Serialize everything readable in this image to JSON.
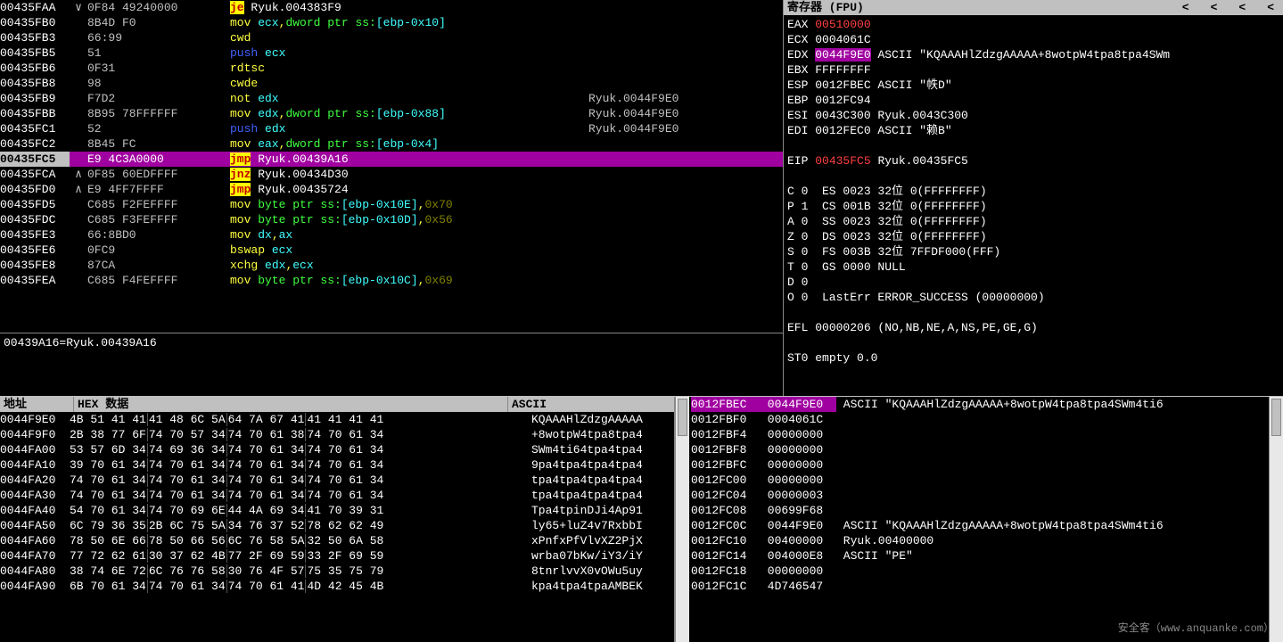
{
  "disasm": {
    "rows": [
      {
        "addr": "00435FAA",
        "arr": "∨",
        "bytes": "0F84 49240000",
        "mnem": "je",
        "mnemCls": "hl-yellow",
        "args": [
          {
            "t": " Ryuk.004383F9",
            "c": "white"
          }
        ]
      },
      {
        "addr": "00435FB0",
        "bytes": "8B4D F0",
        "mnem": "mov",
        "mnemCls": "yellow",
        "args": [
          {
            "t": " ecx",
            "c": "cyan"
          },
          {
            "t": ",",
            "c": "yellow"
          },
          {
            "t": "dword ptr ss:",
            "c": "green"
          },
          {
            "t": "[ebp-0x10]",
            "c": "cyan"
          }
        ]
      },
      {
        "addr": "00435FB3",
        "bytes": "66:99",
        "mnem": "cwd",
        "mnemCls": "yellow"
      },
      {
        "addr": "00435FB5",
        "bytes": "51",
        "mnem": "push",
        "mnemCls": "blue",
        "args": [
          {
            "t": " ecx",
            "c": "cyan"
          }
        ]
      },
      {
        "addr": "00435FB6",
        "bytes": "0F31",
        "mnem": "rdtsc",
        "mnemCls": "yellow"
      },
      {
        "addr": "00435FB8",
        "bytes": "98",
        "mnem": "cwde",
        "mnemCls": "yellow"
      },
      {
        "addr": "00435FB9",
        "bytes": "F7D2",
        "mnem": "not",
        "mnemCls": "yellow",
        "args": [
          {
            "t": " edx",
            "c": "cyan"
          }
        ],
        "cmt": "Ryuk.0044F9E0"
      },
      {
        "addr": "00435FBB",
        "bytes": "8B95 78FFFFFF",
        "mnem": "mov",
        "mnemCls": "yellow",
        "args": [
          {
            "t": " edx",
            "c": "cyan"
          },
          {
            "t": ",",
            "c": "yellow"
          },
          {
            "t": "dword ptr ss:",
            "c": "green"
          },
          {
            "t": "[ebp-0x88]",
            "c": "cyan"
          }
        ],
        "cmt": "Ryuk.0044F9E0"
      },
      {
        "addr": "00435FC1",
        "bytes": "52",
        "mnem": "push",
        "mnemCls": "blue",
        "args": [
          {
            "t": " edx",
            "c": "cyan"
          }
        ],
        "cmt": "Ryuk.0044F9E0"
      },
      {
        "addr": "00435FC2",
        "bytes": "8B45 FC",
        "mnem": "mov",
        "mnemCls": "yellow",
        "args": [
          {
            "t": " eax",
            "c": "cyan"
          },
          {
            "t": ",",
            "c": "yellow"
          },
          {
            "t": "dword ptr ss:",
            "c": "green"
          },
          {
            "t": "[ebp-0x4]",
            "c": "cyan"
          }
        ]
      },
      {
        "addr": "00435FC5",
        "sel": true,
        "bytes": "E9 4C3A0000",
        "mnem": "jmp",
        "mnemCls": "hl-yellow",
        "args": [
          {
            "t": " Ryuk.00439A16",
            "c": "white"
          }
        ],
        "rowCls": "hl-mag"
      },
      {
        "addr": "00435FCA",
        "arr": "∧",
        "bytes": "0F85 60EDFFFF",
        "mnem": "jnz",
        "mnemCls": "hl-yellow",
        "args": [
          {
            "t": " Ryuk.00434D30",
            "c": "white"
          }
        ]
      },
      {
        "addr": "00435FD0",
        "arr": "∧",
        "bytes": "E9 4FF7FFFF",
        "mnem": "jmp",
        "mnemCls": "hl-yellow",
        "args": [
          {
            "t": " Ryuk.00435724",
            "c": "white"
          }
        ]
      },
      {
        "addr": "00435FD5",
        "bytes": "C685 F2FEFFFF ",
        "mnem": "mov",
        "mnemCls": "yellow",
        "args": [
          {
            "t": " byte ptr ss:",
            "c": "green"
          },
          {
            "t": "[ebp-0x10E]",
            "c": "cyan"
          },
          {
            "t": ",",
            "c": "yellow"
          },
          {
            "t": "0x70",
            "c": "olive"
          }
        ]
      },
      {
        "addr": "00435FDC",
        "bytes": "C685 F3FEFFFF ",
        "mnem": "mov",
        "mnemCls": "yellow",
        "args": [
          {
            "t": " byte ptr ss:",
            "c": "green"
          },
          {
            "t": "[ebp-0x10D]",
            "c": "cyan"
          },
          {
            "t": ",",
            "c": "yellow"
          },
          {
            "t": "0x56",
            "c": "olive"
          }
        ]
      },
      {
        "addr": "00435FE3",
        "bytes": "66:8BD0",
        "mnem": "mov",
        "mnemCls": "yellow",
        "args": [
          {
            "t": " dx",
            "c": "cyan"
          },
          {
            "t": ",",
            "c": "yellow"
          },
          {
            "t": "ax",
            "c": "cyan"
          }
        ]
      },
      {
        "addr": "00435FE6",
        "bytes": "0FC9",
        "mnem": "bswap",
        "mnemCls": "yellow",
        "args": [
          {
            "t": " ecx",
            "c": "cyan"
          }
        ]
      },
      {
        "addr": "00435FE8",
        "bytes": "87CA",
        "mnem": "xchg",
        "mnemCls": "yellow",
        "args": [
          {
            "t": " edx",
            "c": "cyan"
          },
          {
            "t": ",",
            "c": "yellow"
          },
          {
            "t": "ecx",
            "c": "cyan"
          }
        ]
      },
      {
        "addr": "00435FEA",
        "bytes": "C685 F4FEFFFF ",
        "mnem": "mov",
        "mnemCls": "yellow",
        "args": [
          {
            "t": " byte ptr ss:",
            "c": "green"
          },
          {
            "t": "[ebp-0x10C]",
            "c": "cyan"
          },
          {
            "t": ",",
            "c": "yellow"
          },
          {
            "t": "0x69",
            "c": "olive"
          }
        ]
      }
    ],
    "info": "00439A16=Ryuk.00439A16"
  },
  "reg": {
    "title": "寄存器 (FPU)",
    "arrows": [
      "<",
      "<",
      "<",
      "<"
    ],
    "lines": [
      [
        {
          "t": "EAX ",
          "c": "white"
        },
        {
          "t": "00510000",
          "c": "red"
        }
      ],
      [
        {
          "t": "ECX ",
          "c": "white"
        },
        {
          "t": "0004061C",
          "c": "white"
        }
      ],
      [
        {
          "t": "EDX ",
          "c": "white"
        },
        {
          "t": "0044F9E0",
          "c": "white",
          "bg": "hl-mag"
        },
        {
          "t": " ASCII \"KQAAAHlZdzgAAAAA+8wotpW4tpa8tpa4SWm",
          "c": "white"
        }
      ],
      [
        {
          "t": "EBX ",
          "c": "white"
        },
        {
          "t": "FFFFFFFF",
          "c": "white"
        }
      ],
      [
        {
          "t": "ESP ",
          "c": "white"
        },
        {
          "t": "0012FBEC ASCII \"帙D\"",
          "c": "white"
        }
      ],
      [
        {
          "t": "EBP ",
          "c": "white"
        },
        {
          "t": "0012FC94",
          "c": "white"
        }
      ],
      [
        {
          "t": "ESI ",
          "c": "white"
        },
        {
          "t": "0043C300 Ryuk.0043C300",
          "c": "white"
        }
      ],
      [
        {
          "t": "EDI ",
          "c": "white"
        },
        {
          "t": "0012FEC0 ASCII \"赖B\"",
          "c": "white"
        }
      ],
      [
        {
          "t": " ",
          "c": "white"
        }
      ],
      [
        {
          "t": "EIP ",
          "c": "white"
        },
        {
          "t": "00435FC5",
          "c": "red"
        },
        {
          "t": " Ryuk.00435FC5",
          "c": "white"
        }
      ],
      [
        {
          "t": " ",
          "c": "white"
        }
      ],
      [
        {
          "t": "C 0  ES 0023 32位 0(FFFFFFFF)",
          "c": "white"
        }
      ],
      [
        {
          "t": "P 1  CS 001B 32位 0(FFFFFFFF)",
          "c": "white"
        }
      ],
      [
        {
          "t": "A 0  SS 0023 32位 0(FFFFFFFF)",
          "c": "white"
        }
      ],
      [
        {
          "t": "Z 0  DS 0023 32位 0(FFFFFFFF)",
          "c": "white"
        }
      ],
      [
        {
          "t": "S 0  FS 003B 32位 7FFDF000(FFF)",
          "c": "white"
        }
      ],
      [
        {
          "t": "T 0  GS 0000 NULL",
          "c": "white"
        }
      ],
      [
        {
          "t": "D 0",
          "c": "white"
        }
      ],
      [
        {
          "t": "O 0  LastErr ERROR_SUCCESS (00000000)",
          "c": "white"
        }
      ],
      [
        {
          "t": " ",
          "c": "white"
        }
      ],
      [
        {
          "t": "EFL ",
          "c": "white"
        },
        {
          "t": "00000206 (NO,NB,NE,A,NS,PE,GE,G)",
          "c": "white"
        }
      ],
      [
        {
          "t": " ",
          "c": "white"
        }
      ],
      [
        {
          "t": "ST0 ",
          "c": "white"
        },
        {
          "t": "empty 0.0",
          "c": "white"
        }
      ]
    ]
  },
  "dump": {
    "hdr": {
      "h1": "地址",
      "h2": "HEX 数据",
      "h3": "ASCII"
    },
    "rows": [
      {
        "a": "0044F9E0",
        "h": "4B 51 41 41|41 48 6C 5A|64 7A 67 41|41 41 41 41",
        "s": "KQAAAHlZdzgAAAAA"
      },
      {
        "a": "0044F9F0",
        "h": "2B 38 77 6F|74 70 57 34|74 70 61 38|74 70 61 34",
        "s": "+8wotpW4tpa8tpa4"
      },
      {
        "a": "0044FA00",
        "h": "53 57 6D 34|74 69 36 34|74 70 61 34|74 70 61 34",
        "s": "SWm4ti64tpa4tpa4"
      },
      {
        "a": "0044FA10",
        "h": "39 70 61 34|74 70 61 34|74 70 61 34|74 70 61 34",
        "s": "9pa4tpa4tpa4tpa4"
      },
      {
        "a": "0044FA20",
        "h": "74 70 61 34|74 70 61 34|74 70 61 34|74 70 61 34",
        "s": "tpa4tpa4tpa4tpa4"
      },
      {
        "a": "0044FA30",
        "h": "74 70 61 34|74 70 61 34|74 70 61 34|74 70 61 34",
        "s": "tpa4tpa4tpa4tpa4"
      },
      {
        "a": "0044FA40",
        "h": "54 70 61 34|74 70 69 6E|44 4A 69 34|41 70 39 31",
        "s": "Tpa4tpinDJi4Ap91"
      },
      {
        "a": "0044FA50",
        "h": "6C 79 36 35|2B 6C 75 5A|34 76 37 52|78 62 62 49",
        "s": "ly65+luZ4v7RxbbI"
      },
      {
        "a": "0044FA60",
        "h": "78 50 6E 66|78 50 66 56|6C 76 58 5A|32 50 6A 58",
        "s": "xPnfxPfVlvXZ2PjX"
      },
      {
        "a": "0044FA70",
        "h": "77 72 62 61|30 37 62 4B|77 2F 69 59|33 2F 69 59",
        "s": "wrba07bKw/iY3/iY"
      },
      {
        "a": "0044FA80",
        "h": "38 74 6E 72|6C 76 76 58|30 76 4F 57|75 35 75 79",
        "s": "8tnrlvvX0vOWu5uy"
      },
      {
        "a": "0044FA90",
        "h": "6B 70 61 34|74 70 61 34|74 70 61 41|4D 42 45 4B",
        "s": "kpa4tpa4tpaAMBEK"
      }
    ]
  },
  "stack": {
    "rows": [
      {
        "a": "0012FBEC",
        "v": "0044F9E0",
        "vh": true,
        "c": "ASCII \"KQAAAHlZdzgAAAAA+8wotpW4tpa8tpa4SWm4ti6"
      },
      {
        "a": "0012FBF0",
        "v": "0004061C"
      },
      {
        "a": "0012FBF4",
        "v": "00000000"
      },
      {
        "a": "0012FBF8",
        "v": "00000000"
      },
      {
        "a": "0012FBFC",
        "v": "00000000"
      },
      {
        "a": "0012FC00",
        "v": "00000000"
      },
      {
        "a": "0012FC04",
        "v": "00000003"
      },
      {
        "a": "0012FC08",
        "v": "00699F68"
      },
      {
        "a": "0012FC0C",
        "v": "0044F9E0",
        "c": "ASCII \"KQAAAHlZdzgAAAAA+8wotpW4tpa8tpa4SWm4ti6"
      },
      {
        "a": "0012FC10",
        "v": "00400000",
        "c": "Ryuk.00400000"
      },
      {
        "a": "0012FC14",
        "v": "004000E8",
        "c": "ASCII \"PE\""
      },
      {
        "a": "0012FC18",
        "v": "00000000"
      },
      {
        "a": "0012FC1C",
        "v": "4D746547"
      }
    ]
  },
  "watermark": "安全客（www.anquanke.com）"
}
